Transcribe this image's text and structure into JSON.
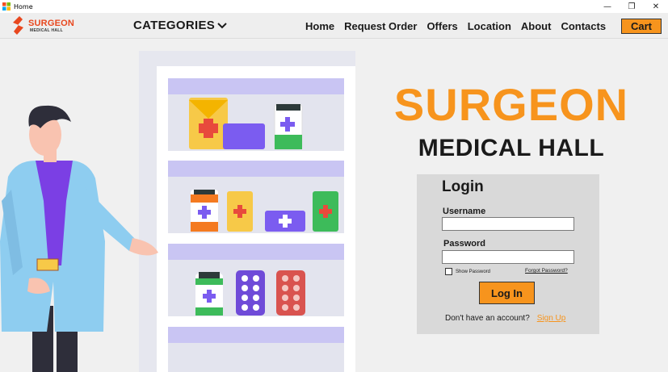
{
  "window": {
    "title": "Home",
    "controls": [
      "—",
      "❐",
      "✕"
    ]
  },
  "brand": {
    "name": "SURGEON",
    "sub": "MEDICAL HALL"
  },
  "nav": {
    "categories": "CATEGORIES",
    "links": [
      "Home",
      "Request Order",
      "Offers",
      "Location",
      "About",
      "Contacts"
    ],
    "cart": "Cart"
  },
  "hero": {
    "title": "SURGEON",
    "subtitle": "MEDICAL HALL"
  },
  "login": {
    "title": "Login",
    "username_label": "Username",
    "username_value": "",
    "password_label": "Password",
    "password_value": "",
    "show_password": "Show Password",
    "show_password_checked": false,
    "forgot": "Forgot Password?",
    "button": "Log In",
    "no_account": "Don't have an account?",
    "signup": "Sign Up"
  },
  "colors": {
    "accent": "#f7941d",
    "logo_red": "#e8471e",
    "panel": "#d9d9d9"
  }
}
